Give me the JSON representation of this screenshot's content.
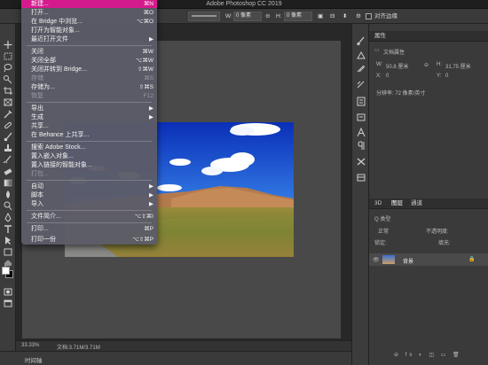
{
  "app": {
    "title": "Adobe Photoshop CC 2019"
  },
  "options_bar": {
    "w_label": "W:",
    "w_value": "0 像素",
    "h_label": "H:",
    "h_value": "0 像素",
    "align_edges_label": "对齐边缘"
  },
  "file_menu": {
    "items": [
      {
        "label": "新建...",
        "shortcut": "⌘N",
        "disabled": false,
        "highlighted": true
      },
      {
        "label": "打开...",
        "shortcut": "⌘O",
        "disabled": false,
        "highlighted": false
      },
      {
        "label": "在 Bridge 中浏览...",
        "shortcut": "⌥⌘O",
        "disabled": false,
        "highlighted": false
      },
      {
        "label": "打开为智能对象...",
        "shortcut": "",
        "disabled": false,
        "highlighted": false
      },
      {
        "label": "最近打开文件",
        "shortcut": "▶",
        "disabled": false,
        "highlighted": false
      },
      {
        "label": "关闭",
        "shortcut": "⌘W",
        "disabled": false,
        "highlighted": false
      },
      {
        "label": "关闭全部",
        "shortcut": "⌥⌘W",
        "disabled": false,
        "highlighted": false
      },
      {
        "label": "关闭并转到 Bridge...",
        "shortcut": "⇧⌘W",
        "disabled": false,
        "highlighted": false
      },
      {
        "label": "存储",
        "shortcut": "⌘S",
        "disabled": true,
        "highlighted": false
      },
      {
        "label": "存储为...",
        "shortcut": "⇧⌘S",
        "disabled": false,
        "highlighted": false
      },
      {
        "label": "恢复",
        "shortcut": "F12",
        "disabled": true,
        "highlighted": false
      },
      {
        "label": "导出",
        "shortcut": "▶",
        "disabled": false,
        "highlighted": false
      },
      {
        "label": "生成",
        "shortcut": "▶",
        "disabled": false,
        "highlighted": false
      },
      {
        "label": "共享...",
        "shortcut": "",
        "disabled": false,
        "highlighted": false
      },
      {
        "label": "在 Behance 上共享...",
        "shortcut": "",
        "disabled": false,
        "highlighted": false
      },
      {
        "label": "搜索 Adobe Stock...",
        "shortcut": "",
        "disabled": false,
        "highlighted": false
      },
      {
        "label": "置入嵌入对象...",
        "shortcut": "",
        "disabled": false,
        "highlighted": false
      },
      {
        "label": "置入链接的智能对象...",
        "shortcut": "",
        "disabled": false,
        "highlighted": false
      },
      {
        "label": "打包...",
        "shortcut": "",
        "disabled": true,
        "highlighted": false
      },
      {
        "label": "自动",
        "shortcut": "▶",
        "disabled": false,
        "highlighted": false
      },
      {
        "label": "脚本",
        "shortcut": "▶",
        "disabled": false,
        "highlighted": false
      },
      {
        "label": "导入",
        "shortcut": "▶",
        "disabled": false,
        "highlighted": false
      },
      {
        "label": "文件简介...",
        "shortcut": "⌥⇧⌘I",
        "disabled": false,
        "highlighted": false
      },
      {
        "label": "打印...",
        "shortcut": "⌘P",
        "disabled": false,
        "highlighted": false
      },
      {
        "label": "打印一份",
        "shortcut": "⌥⇧⌘P",
        "disabled": false,
        "highlighted": false
      }
    ]
  },
  "status_bar": {
    "zoom": "33.33%",
    "doc_info": "文档:3.71M/3.71M"
  },
  "timeline": {
    "label": "时间轴"
  },
  "properties_panel": {
    "tab": "属性",
    "section": "文档属性",
    "w_label": "W:",
    "w_value": "50.8 厘米",
    "h_label": "H:",
    "h_value": "31.75 厘米",
    "x_label": "X:",
    "x_value": "0",
    "y_label": "Y:",
    "y_value": "0",
    "resolution": "分辨率: 72 像素/英寸"
  },
  "layers_panel": {
    "tabs": [
      "3D",
      "图层",
      "通道"
    ],
    "blend_mode": "正常",
    "opacity": "不透明度:",
    "lock": "锁定:",
    "fill": "填充:",
    "layer_name": "背景"
  },
  "colors": {
    "highlight": "#d51a8d",
    "menu_bg": "#5c5c68",
    "panel_bg": "#3a3a3a",
    "canvas_bg": "#282828"
  }
}
